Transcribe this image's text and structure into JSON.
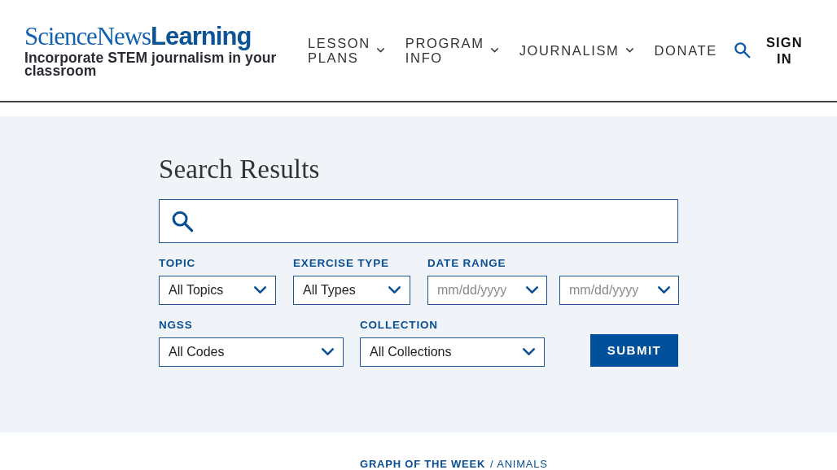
{
  "header": {
    "logo": {
      "serif_part": "ScienceNews",
      "bold_part": "Learning"
    },
    "tagline": "Incorporate STEM journalism in your classroom",
    "nav": [
      {
        "label": "LESSON PLANS",
        "has_menu": true
      },
      {
        "label": "PROGRAM INFO",
        "has_menu": true
      },
      {
        "label": "JOURNALISM",
        "has_menu": true
      },
      {
        "label": "DONATE",
        "has_menu": false
      }
    ],
    "sign_in": "SIGN IN"
  },
  "search": {
    "title": "Search Results"
  },
  "filter_rows": [
    {
      "filters": [
        {
          "label": "TOPIC",
          "fields": [
            {
              "kind": "select",
              "value": "All Topics"
            }
          ]
        },
        {
          "label": "EXERCISE TYPE",
          "fields": [
            {
              "kind": "select",
              "value": "All Types"
            }
          ]
        },
        {
          "label": "DATE RANGE",
          "fields": [
            {
              "kind": "date",
              "placeholder": "mm/dd/yyyy"
            },
            {
              "kind": "date",
              "placeholder": "mm/dd/yyyy"
            }
          ]
        }
      ]
    },
    {
      "filters": [
        {
          "label": "NGSS",
          "fields": [
            {
              "kind": "select",
              "value": "All Codes"
            }
          ]
        },
        {
          "label": "COLLECTION",
          "fields": [
            {
              "kind": "select",
              "value": "All Collections"
            }
          ]
        }
      ]
    }
  ],
  "submit_button": "SUBMIT",
  "featured": {
    "category": "GRAPH OF THE WEEK",
    "subcategory": "/ ANIMALS"
  }
}
